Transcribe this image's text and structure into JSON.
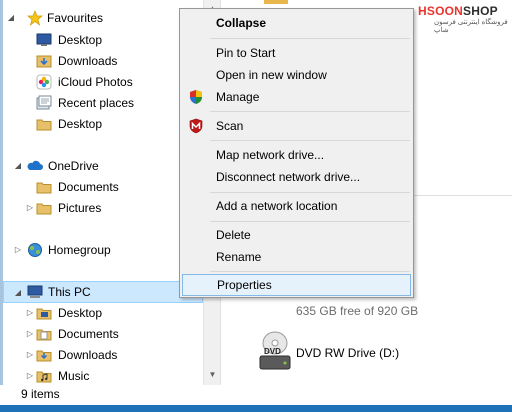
{
  "watermark": {
    "brand_a": "HSOON",
    "brand_b": "SHOP",
    "tagline": "فروشگاه اینترنتی فرسون شاپ"
  },
  "nav": {
    "items": [
      {
        "label": "Favourites",
        "icon": "star-icon",
        "expander": "chevron-down-icon"
      },
      {
        "label": "Desktop",
        "icon": "desktop-icon"
      },
      {
        "label": "Downloads",
        "icon": "downloads-folder-icon"
      },
      {
        "label": "iCloud Photos",
        "icon": "icloud-photos-icon"
      },
      {
        "label": "Recent places",
        "icon": "recent-places-icon"
      },
      {
        "label": "Desktop",
        "icon": "folder-icon"
      },
      {
        "label": "OneDrive",
        "icon": "onedrive-cloud-icon",
        "expander": "chevron-down-icon"
      },
      {
        "label": "Documents",
        "icon": "folder-icon"
      },
      {
        "label": "Pictures",
        "icon": "folder-icon",
        "expander": "chevron-right-icon"
      },
      {
        "label": "Homegroup",
        "icon": "homegroup-icon",
        "expander": "chevron-right-icon"
      },
      {
        "label": "This PC",
        "icon": "computer-icon",
        "expander": "chevron-down-icon"
      },
      {
        "label": "Desktop",
        "icon": "desktop-folder-icon",
        "expander": "chevron-right-icon"
      },
      {
        "label": "Documents",
        "icon": "documents-folder-icon",
        "expander": "chevron-right-icon"
      },
      {
        "label": "Downloads",
        "icon": "downloads-folder-icon",
        "expander": "chevron-right-icon"
      },
      {
        "label": "Music",
        "icon": "music-folder-icon",
        "expander": "chevron-right-icon"
      }
    ]
  },
  "context_menu": {
    "items": [
      {
        "label": "Collapse",
        "bold": true
      },
      {
        "label": "Pin to Start"
      },
      {
        "label": "Open in new window"
      },
      {
        "label": "Manage",
        "icon": "shield-icon"
      },
      {
        "label": "Scan",
        "icon": "mcafee-icon"
      },
      {
        "label": "Map network drive..."
      },
      {
        "label": "Disconnect network drive..."
      },
      {
        "label": "Add a network location"
      },
      {
        "label": "Delete"
      },
      {
        "label": "Rename"
      },
      {
        "label": "Properties",
        "highlighted": true
      }
    ]
  },
  "content": {
    "drive_free_text": "635 GB free of 920 GB",
    "drive_used_fraction": 0.31,
    "dvd_label": "DVD RW Drive (D:)",
    "dvd_badge": "DVD"
  },
  "status_bar": {
    "item_count": "9 items"
  },
  "colors": {
    "selection": "#cce8ff",
    "accent": "#26a0da",
    "frame": "#1e73b8"
  }
}
